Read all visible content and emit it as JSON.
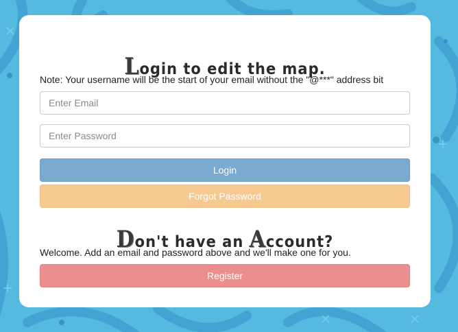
{
  "login_heading": {
    "cap": "L",
    "rest": "ogin to edit the map",
    "end": "."
  },
  "note": "Note: Your username will be the start of your email without the \"@***\" address bit",
  "email_input": {
    "placeholder": "Enter Email",
    "value": ""
  },
  "password_input": {
    "placeholder": "Enter Password",
    "value": ""
  },
  "buttons": {
    "login": "Login",
    "forgot": "Forgot Password",
    "register": "Register"
  },
  "account_heading": {
    "cap1": "D",
    "part1": "on't have an ",
    "cap2": "A",
    "part2": "ccount?"
  },
  "welcome": "Welcome. Add an email and password above and we'll make one for you.",
  "colors": {
    "background": "#56b9e0",
    "login_button": "#78abcf",
    "forgot_button": "#f6c990",
    "register_button": "#ec8e8e"
  }
}
